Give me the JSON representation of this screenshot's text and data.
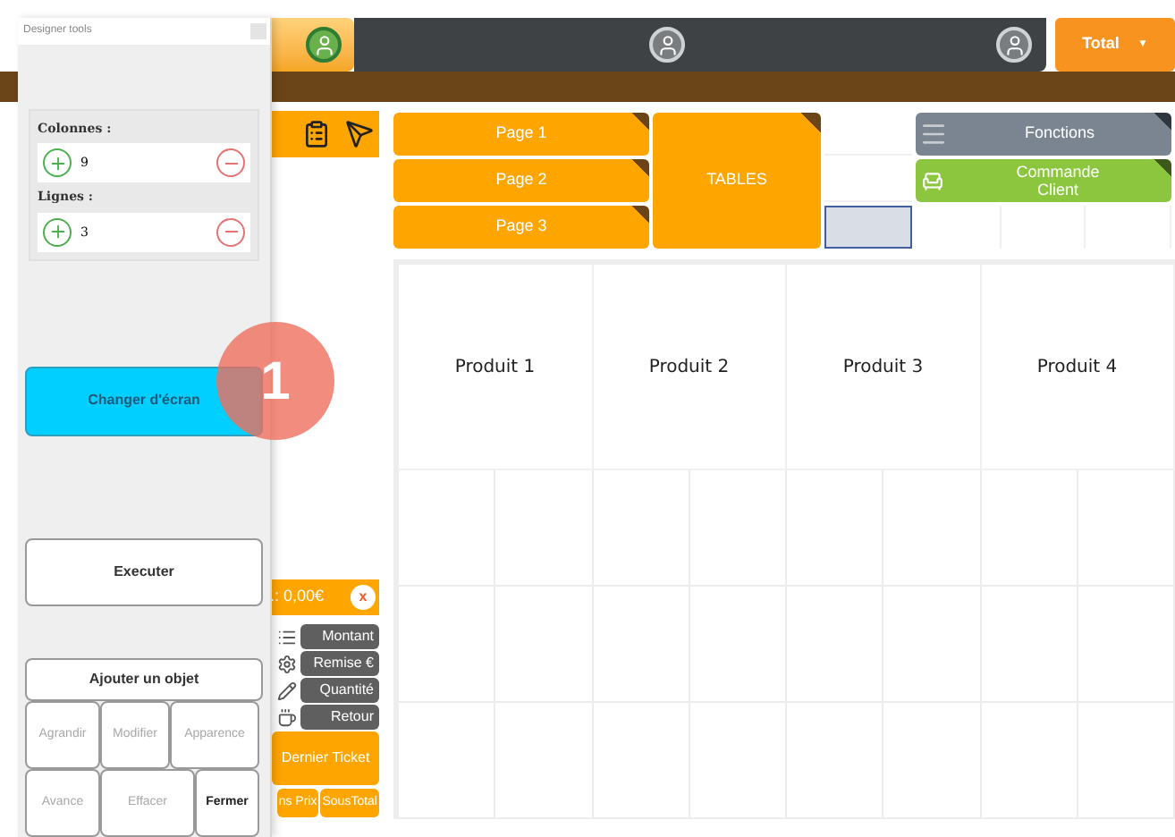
{
  "top_bar": {
    "total_button": "Total",
    "total_caret": "▼"
  },
  "left_column": {
    "total": ".: 0,00€",
    "clear_button": "x",
    "functions": [
      {
        "label": "Montant",
        "kind": "list"
      },
      {
        "label": "Remise €",
        "kind": "gear"
      },
      {
        "label": "Quantité",
        "kind": "pencil"
      },
      {
        "label": "Retour",
        "kind": "cup"
      }
    ],
    "last_ticket": "Dernier Ticket",
    "bottom_buttons": [
      "ns Prix",
      "SousTotal"
    ]
  },
  "pages": [
    {
      "label": "Page 1"
    },
    {
      "label": "Page 2"
    },
    {
      "label": "Page 3"
    }
  ],
  "tables_button": "TABLES",
  "functions_button": "Fonctions",
  "customer_order_button": "Commande Client",
  "empty_cells": [
    {
      "selected": false
    },
    {
      "selected": false
    },
    {
      "selected": true
    }
  ],
  "products": [
    "Produit 1",
    "Produit 2",
    "Produit 3",
    "Produit 4"
  ],
  "designer_panel": {
    "title": "Designer tools",
    "fields": [
      {
        "label": "Colonnes :",
        "value": "9"
      },
      {
        "label": "Lignes :",
        "value": "3"
      }
    ],
    "change_screen_button": "Changer d'écran",
    "execute_button": "Executer",
    "add_object_button": "Ajouter un objet",
    "object_actions": [
      [
        {
          "label": "Agrandir",
          "disabled": true
        },
        {
          "label": "Modifier",
          "disabled": true
        },
        {
          "label": "Apparence",
          "disabled": true
        }
      ],
      [
        {
          "label": "Avance",
          "disabled": true
        },
        {
          "label": "Effacer",
          "disabled": true
        },
        {
          "label": "Fermer",
          "disabled": false
        }
      ]
    ]
  },
  "step_badge": "1"
}
